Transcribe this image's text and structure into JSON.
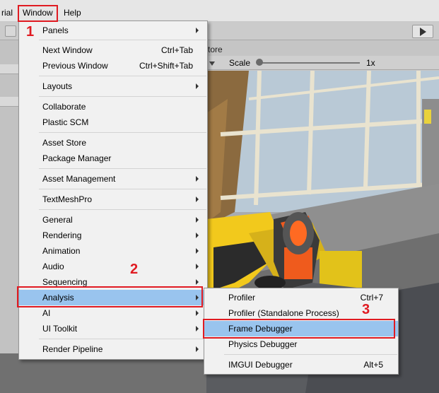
{
  "menubar": {
    "items": [
      {
        "label": "rial"
      },
      {
        "label": "Window"
      },
      {
        "label": "Help"
      }
    ]
  },
  "scene_view": {
    "tab_label": "tore",
    "scale_label": "Scale",
    "scale_value": "1x"
  },
  "window_menu": {
    "items": [
      {
        "label": "Panels",
        "submenu": true
      },
      {
        "label": "Next Window",
        "shortcut": "Ctrl+Tab"
      },
      {
        "label": "Previous Window",
        "shortcut": "Ctrl+Shift+Tab"
      },
      {
        "label": "Layouts",
        "submenu": true
      },
      {
        "label": "Collaborate"
      },
      {
        "label": "Plastic SCM"
      },
      {
        "label": "Asset Store"
      },
      {
        "label": "Package Manager"
      },
      {
        "label": "Asset Management",
        "submenu": true
      },
      {
        "label": "TextMeshPro",
        "submenu": true
      },
      {
        "label": "General",
        "submenu": true
      },
      {
        "label": "Rendering",
        "submenu": true
      },
      {
        "label": "Animation",
        "submenu": true
      },
      {
        "label": "Audio",
        "submenu": true
      },
      {
        "label": "Sequencing",
        "submenu": true
      },
      {
        "label": "Analysis",
        "submenu": true,
        "highlighted": true
      },
      {
        "label": "AI",
        "submenu": true
      },
      {
        "label": "UI Toolkit",
        "submenu": true
      },
      {
        "label": "Render Pipeline",
        "submenu": true
      }
    ]
  },
  "analysis_submenu": {
    "items": [
      {
        "label": "Profiler",
        "shortcut": "Ctrl+7"
      },
      {
        "label": "Profiler (Standalone Process)"
      },
      {
        "label": "Frame Debugger",
        "highlighted": true
      },
      {
        "label": "Physics Debugger"
      },
      {
        "label": "IMGUI Debugger",
        "shortcut": "Alt+5"
      }
    ]
  },
  "annotations": {
    "step1": "1",
    "step2": "2",
    "step3": "3",
    "color": "#e01b22"
  },
  "colors": {
    "menu_highlight": "#99c4ee",
    "menu_background": "#f1f1f1"
  }
}
